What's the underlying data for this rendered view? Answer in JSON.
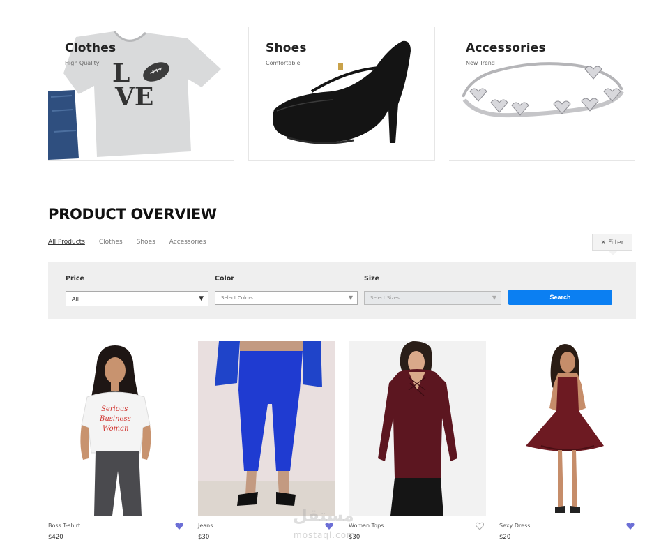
{
  "banners": [
    {
      "title": "Clothes",
      "subtitle": "High Quality"
    },
    {
      "title": "Shoes",
      "subtitle": "Comfortable"
    },
    {
      "title": "Accessories",
      "subtitle": "New Trend"
    }
  ],
  "overview": {
    "title": "PRODUCT OVERVIEW",
    "tabs": [
      "All Products",
      "Clothes",
      "Shoes",
      "Accessories"
    ],
    "filter_button": "Filter",
    "filter_icon": "close-icon"
  },
  "filters": {
    "price": {
      "label": "Price",
      "value": "All"
    },
    "color": {
      "label": "Color",
      "placeholder": "Select Colors"
    },
    "size": {
      "label": "Size",
      "placeholder": "Select Sizes"
    },
    "search_label": "Search"
  },
  "colors": {
    "accent_blue": "#0b7ff2",
    "heart_filled": "#6c6fd6",
    "panel_bg": "#efefef"
  },
  "products": [
    {
      "name": "Boss T-shirt",
      "price": "$420",
      "favorite": true
    },
    {
      "name": "Jeans",
      "price": "$30",
      "favorite": true
    },
    {
      "name": "Woman Tops",
      "price": "$30",
      "favorite": false
    },
    {
      "name": "Sexy Dress",
      "price": "$20",
      "favorite": true
    }
  ],
  "watermark": {
    "arabic": "مستقل",
    "latin": "mostaql.com"
  }
}
